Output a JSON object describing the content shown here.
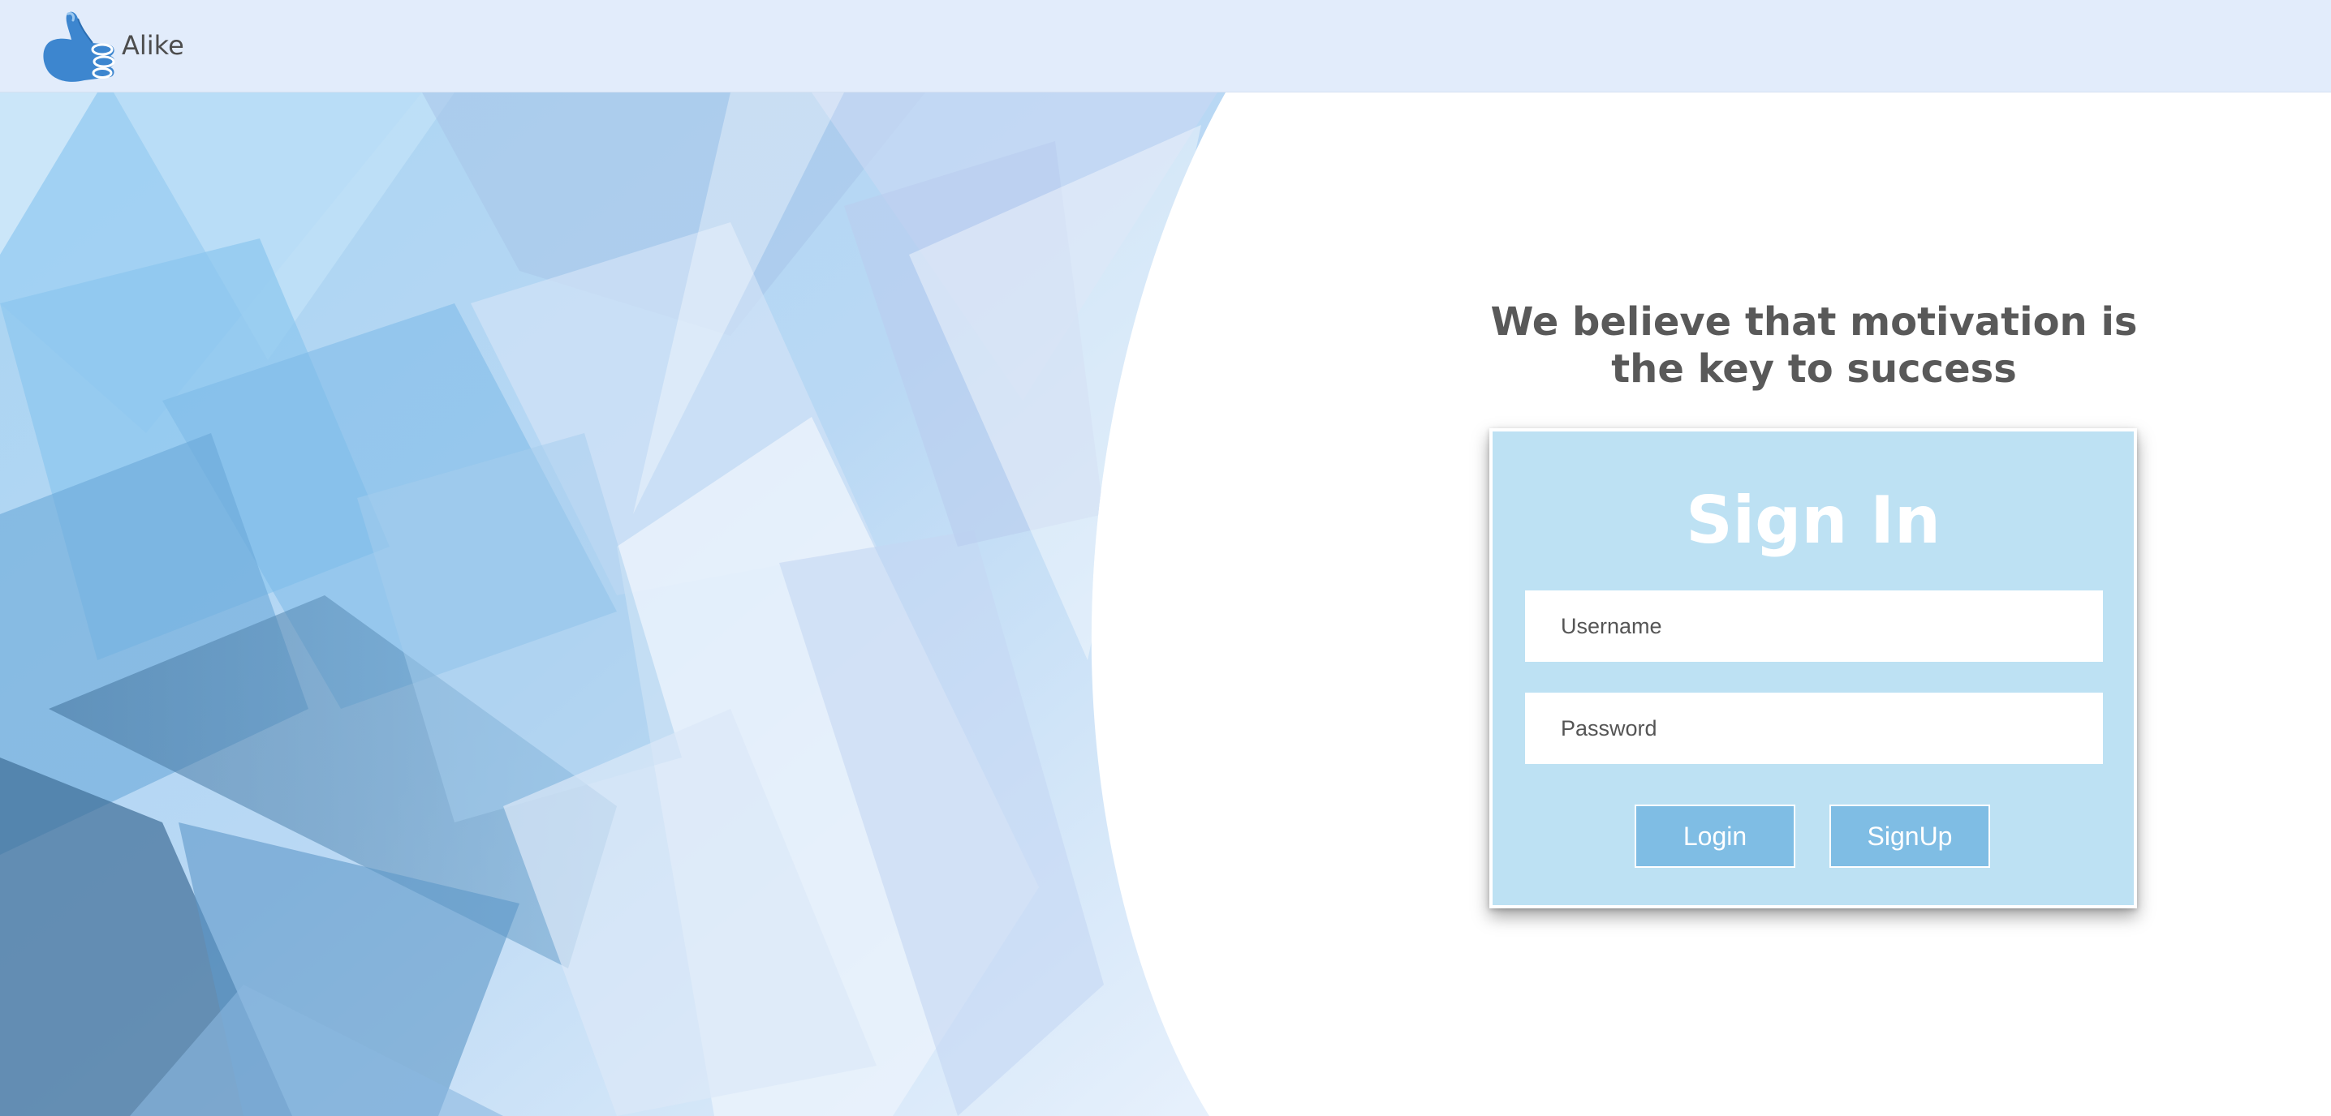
{
  "brand": {
    "name": "Alike",
    "logo_icon": "thumbs-up-icon"
  },
  "colors": {
    "topbar_bg": "#e2ecfb",
    "card_bg": "#bde1f3",
    "button_bg": "#7fbde4",
    "tagline_color": "#595959"
  },
  "hero": {
    "image_icon": "abstract-blue-crystal-background"
  },
  "tagline": "We believe that motivation is the key to success",
  "login": {
    "title": "Sign In",
    "username_placeholder": "Username",
    "password_placeholder": "Password",
    "login_label": "Login",
    "signup_label": "SignUp"
  }
}
